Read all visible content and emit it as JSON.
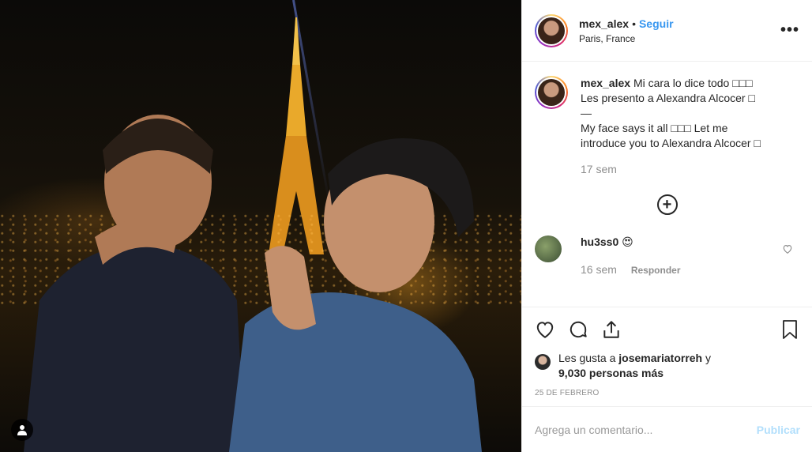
{
  "post": {
    "photo_alt": "",
    "user_tag_icon": "user-tag-icon"
  },
  "header": {
    "username": "mex_alex",
    "separator": "•",
    "follow_label": "Seguir",
    "location": "Paris, France",
    "more_icon": "more-options-icon"
  },
  "caption": {
    "username": "mex_alex",
    "text_es_1": "Mi cara lo dice todo □□□",
    "text_es_2": "Les presento a Alexandra Alcocer □",
    "dash": "—",
    "text_en_1": "My face says it all □□□ Let me",
    "text_en_2": "introduce you to Alexandra Alcocer □",
    "time": "17 sem"
  },
  "load_more_icon": "plus-circle-icon",
  "comments": [
    {
      "username": "hu3ss0",
      "text": "😍",
      "time": "16 sem",
      "reply_label": "Responder"
    }
  ],
  "actions": {
    "like_icon": "heart-icon",
    "comment_icon": "comment-icon",
    "share_icon": "share-icon",
    "save_icon": "bookmark-icon"
  },
  "likes": {
    "prefix": "Les gusta a",
    "user": "josemariatorreh",
    "conj": "y",
    "count_text": "9,030 personas más"
  },
  "date": "25 DE FEBRERO",
  "comment_box": {
    "placeholder": "Agrega un comentario...",
    "publish_label": "Publicar"
  },
  "colors": {
    "accent": "#3897f0",
    "publish_disabled": "#b2dffc",
    "muted": "#8e8e8e"
  }
}
